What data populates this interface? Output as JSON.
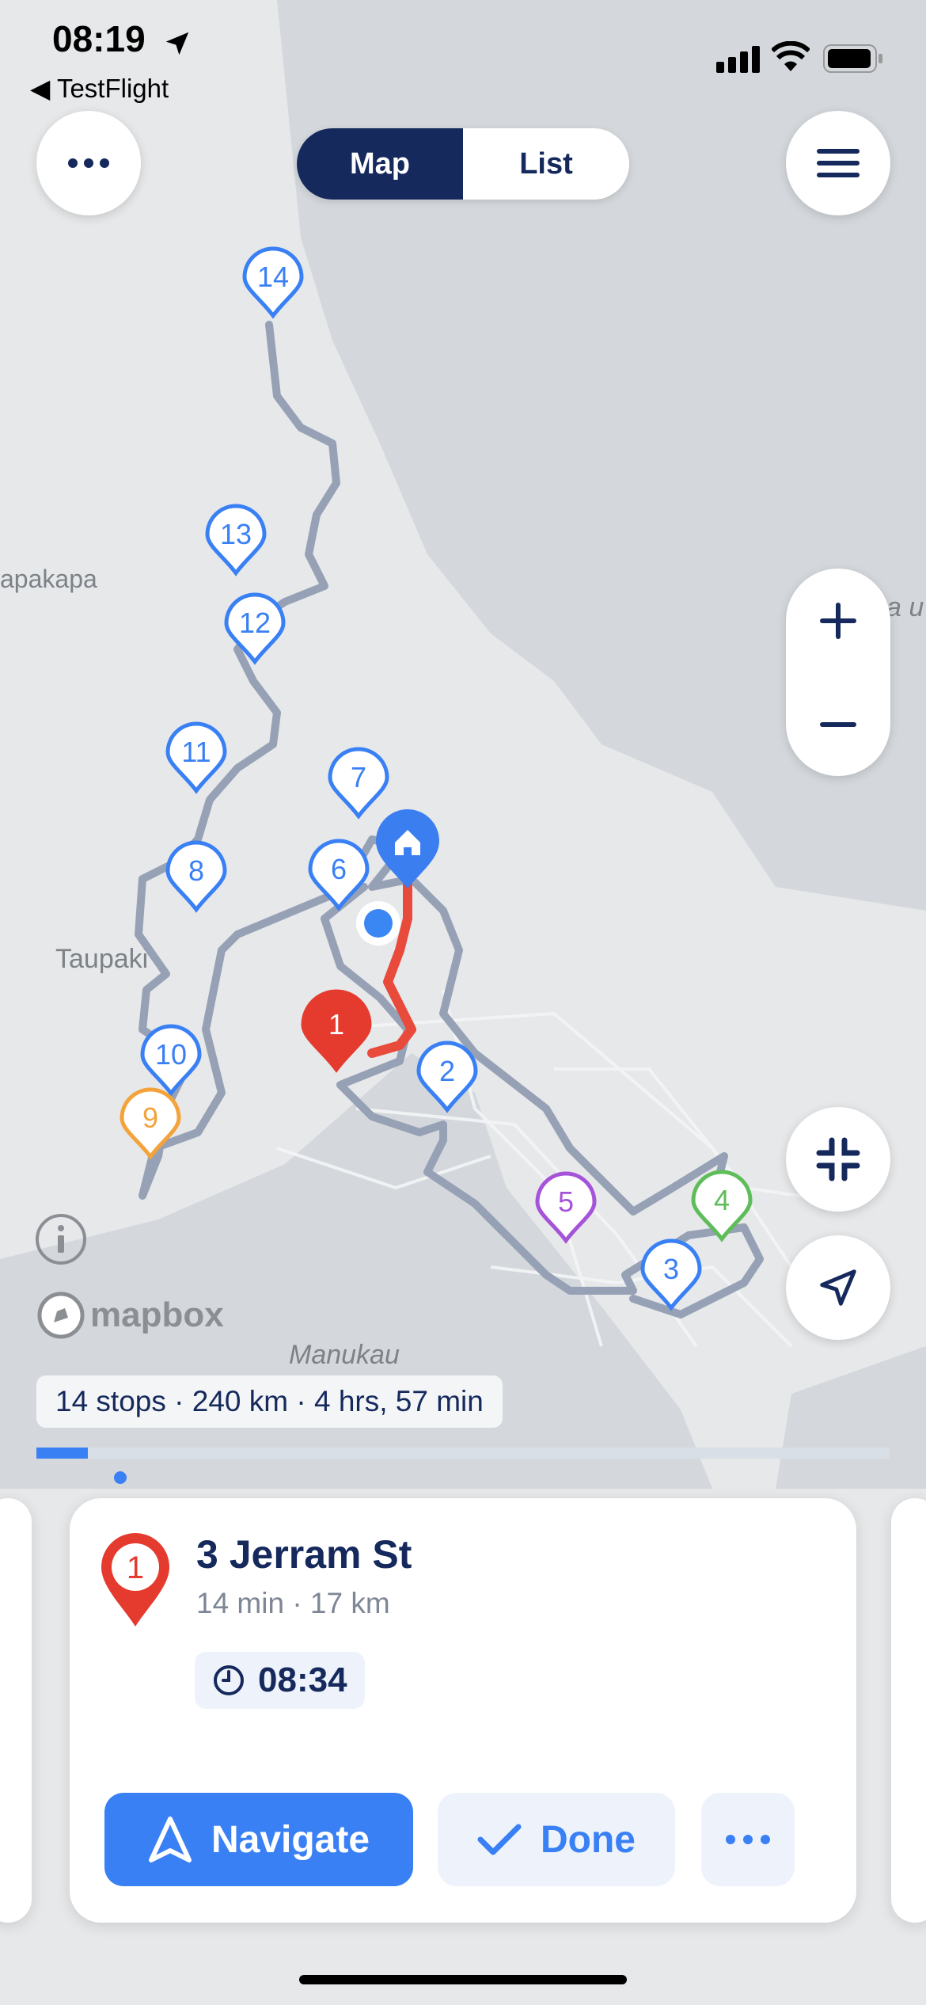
{
  "status_bar": {
    "time": "08:19",
    "back_label": "TestFlight"
  },
  "header": {
    "segment_map": "Map",
    "segment_list": "List"
  },
  "map": {
    "place_labels": [
      "apakapa",
      "Taupaki",
      "Manukau",
      "a u"
    ],
    "stops": [
      {
        "label": "14",
        "color": "#3a80f5"
      },
      {
        "label": "13",
        "color": "#3a80f5"
      },
      {
        "label": "12",
        "color": "#3a80f5"
      },
      {
        "label": "11",
        "color": "#3a80f5"
      },
      {
        "label": "7",
        "color": "#3a80f5"
      },
      {
        "label": "8",
        "color": "#3a80f5"
      },
      {
        "label": "6",
        "color": "#3a80f5"
      },
      {
        "label": "10",
        "color": "#3a80f5"
      },
      {
        "label": "9",
        "color": "#f3a33a"
      },
      {
        "label": "2",
        "color": "#3a80f5"
      },
      {
        "label": "5",
        "color": "#a553d9"
      },
      {
        "label": "4",
        "color": "#5ebd5a"
      },
      {
        "label": "3",
        "color": "#3a80f5"
      },
      {
        "label": "1",
        "color": "#e53a2e"
      }
    ],
    "attribution": "mapbox"
  },
  "summary": {
    "text": "14 stops · 240 km · 4 hrs, 57 min",
    "progress_fraction": 0.06
  },
  "card": {
    "stop_number": "1",
    "title": "3 Jerram St",
    "subtitle": "14 min · 17 km",
    "eta": "08:34",
    "navigate_label": "Navigate",
    "done_label": "Done"
  },
  "colors": {
    "brand_navy": "#15295c",
    "accent_blue": "#3a80f5",
    "current_stop_red": "#e53a2e"
  }
}
